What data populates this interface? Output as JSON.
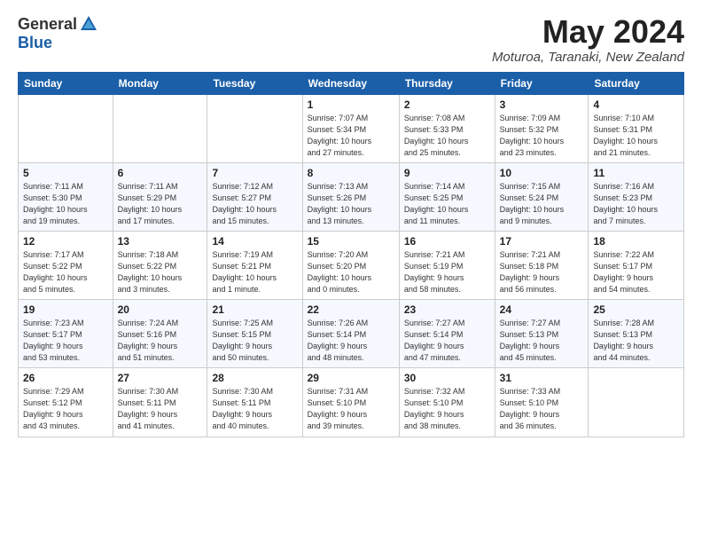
{
  "header": {
    "logo_general": "General",
    "logo_blue": "Blue",
    "month_title": "May 2024",
    "location": "Moturoa, Taranaki, New Zealand"
  },
  "weekdays": [
    "Sunday",
    "Monday",
    "Tuesday",
    "Wednesday",
    "Thursday",
    "Friday",
    "Saturday"
  ],
  "weeks": [
    [
      {
        "day": "",
        "info": ""
      },
      {
        "day": "",
        "info": ""
      },
      {
        "day": "",
        "info": ""
      },
      {
        "day": "1",
        "info": "Sunrise: 7:07 AM\nSunset: 5:34 PM\nDaylight: 10 hours\nand 27 minutes."
      },
      {
        "day": "2",
        "info": "Sunrise: 7:08 AM\nSunset: 5:33 PM\nDaylight: 10 hours\nand 25 minutes."
      },
      {
        "day": "3",
        "info": "Sunrise: 7:09 AM\nSunset: 5:32 PM\nDaylight: 10 hours\nand 23 minutes."
      },
      {
        "day": "4",
        "info": "Sunrise: 7:10 AM\nSunset: 5:31 PM\nDaylight: 10 hours\nand 21 minutes."
      }
    ],
    [
      {
        "day": "5",
        "info": "Sunrise: 7:11 AM\nSunset: 5:30 PM\nDaylight: 10 hours\nand 19 minutes."
      },
      {
        "day": "6",
        "info": "Sunrise: 7:11 AM\nSunset: 5:29 PM\nDaylight: 10 hours\nand 17 minutes."
      },
      {
        "day": "7",
        "info": "Sunrise: 7:12 AM\nSunset: 5:27 PM\nDaylight: 10 hours\nand 15 minutes."
      },
      {
        "day": "8",
        "info": "Sunrise: 7:13 AM\nSunset: 5:26 PM\nDaylight: 10 hours\nand 13 minutes."
      },
      {
        "day": "9",
        "info": "Sunrise: 7:14 AM\nSunset: 5:25 PM\nDaylight: 10 hours\nand 11 minutes."
      },
      {
        "day": "10",
        "info": "Sunrise: 7:15 AM\nSunset: 5:24 PM\nDaylight: 10 hours\nand 9 minutes."
      },
      {
        "day": "11",
        "info": "Sunrise: 7:16 AM\nSunset: 5:23 PM\nDaylight: 10 hours\nand 7 minutes."
      }
    ],
    [
      {
        "day": "12",
        "info": "Sunrise: 7:17 AM\nSunset: 5:22 PM\nDaylight: 10 hours\nand 5 minutes."
      },
      {
        "day": "13",
        "info": "Sunrise: 7:18 AM\nSunset: 5:22 PM\nDaylight: 10 hours\nand 3 minutes."
      },
      {
        "day": "14",
        "info": "Sunrise: 7:19 AM\nSunset: 5:21 PM\nDaylight: 10 hours\nand 1 minute."
      },
      {
        "day": "15",
        "info": "Sunrise: 7:20 AM\nSunset: 5:20 PM\nDaylight: 10 hours\nand 0 minutes."
      },
      {
        "day": "16",
        "info": "Sunrise: 7:21 AM\nSunset: 5:19 PM\nDaylight: 9 hours\nand 58 minutes."
      },
      {
        "day": "17",
        "info": "Sunrise: 7:21 AM\nSunset: 5:18 PM\nDaylight: 9 hours\nand 56 minutes."
      },
      {
        "day": "18",
        "info": "Sunrise: 7:22 AM\nSunset: 5:17 PM\nDaylight: 9 hours\nand 54 minutes."
      }
    ],
    [
      {
        "day": "19",
        "info": "Sunrise: 7:23 AM\nSunset: 5:17 PM\nDaylight: 9 hours\nand 53 minutes."
      },
      {
        "day": "20",
        "info": "Sunrise: 7:24 AM\nSunset: 5:16 PM\nDaylight: 9 hours\nand 51 minutes."
      },
      {
        "day": "21",
        "info": "Sunrise: 7:25 AM\nSunset: 5:15 PM\nDaylight: 9 hours\nand 50 minutes."
      },
      {
        "day": "22",
        "info": "Sunrise: 7:26 AM\nSunset: 5:14 PM\nDaylight: 9 hours\nand 48 minutes."
      },
      {
        "day": "23",
        "info": "Sunrise: 7:27 AM\nSunset: 5:14 PM\nDaylight: 9 hours\nand 47 minutes."
      },
      {
        "day": "24",
        "info": "Sunrise: 7:27 AM\nSunset: 5:13 PM\nDaylight: 9 hours\nand 45 minutes."
      },
      {
        "day": "25",
        "info": "Sunrise: 7:28 AM\nSunset: 5:13 PM\nDaylight: 9 hours\nand 44 minutes."
      }
    ],
    [
      {
        "day": "26",
        "info": "Sunrise: 7:29 AM\nSunset: 5:12 PM\nDaylight: 9 hours\nand 43 minutes."
      },
      {
        "day": "27",
        "info": "Sunrise: 7:30 AM\nSunset: 5:11 PM\nDaylight: 9 hours\nand 41 minutes."
      },
      {
        "day": "28",
        "info": "Sunrise: 7:30 AM\nSunset: 5:11 PM\nDaylight: 9 hours\nand 40 minutes."
      },
      {
        "day": "29",
        "info": "Sunrise: 7:31 AM\nSunset: 5:10 PM\nDaylight: 9 hours\nand 39 minutes."
      },
      {
        "day": "30",
        "info": "Sunrise: 7:32 AM\nSunset: 5:10 PM\nDaylight: 9 hours\nand 38 minutes."
      },
      {
        "day": "31",
        "info": "Sunrise: 7:33 AM\nSunset: 5:10 PM\nDaylight: 9 hours\nand 36 minutes."
      },
      {
        "day": "",
        "info": ""
      }
    ]
  ]
}
